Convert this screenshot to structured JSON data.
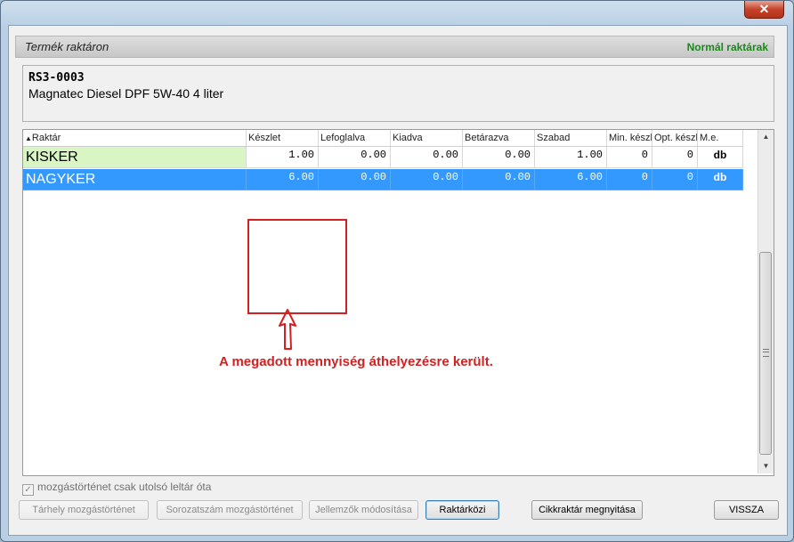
{
  "window": {
    "close_glyph": "✕"
  },
  "header": {
    "title": "Termék raktáron",
    "right_label": "Normál raktárak"
  },
  "product": {
    "code": "RS3-0003",
    "name": "Magnatec Diesel DPF 5W-40 4 liter"
  },
  "grid": {
    "sort_icon": "sort-ascending-icon",
    "columns": [
      "Raktár",
      "Készlet",
      "Lefoglalva",
      "Kiadva",
      "Betárazva",
      "Szabad",
      "Min. készl",
      "Opt. készl",
      "M.e."
    ],
    "rows": [
      {
        "raktar": "KISKER",
        "keszlet": "1.00",
        "lefoglalva": "0.00",
        "kiadva": "0.00",
        "betarazva": "0.00",
        "szabad": "1.00",
        "min": "0",
        "opt": "0",
        "me": "db"
      },
      {
        "raktar": "NAGYKER",
        "keszlet": "6.00",
        "lefoglalva": "0.00",
        "kiadva": "0.00",
        "betarazva": "0.00",
        "szabad": "6.00",
        "min": "0",
        "opt": "0",
        "me": "db"
      }
    ]
  },
  "annotation": {
    "text": "A megadott mennyiség áthelyezésre került."
  },
  "checkbox": {
    "label": "mozgástörténet csak utolsó leltár óta",
    "checked": true
  },
  "buttons": {
    "tarhely": "Tárhely mozgástörténet",
    "sorozatszam": "Sorozatszám mozgástörténet",
    "jellemzok": "Jellemzők módosítása",
    "raktarkozi": "Raktárközi",
    "cikkraktar": "Cikkraktár megnyitása",
    "vissza": "VISSZA"
  },
  "colors": {
    "accent_green": "#1a8a1a",
    "selection": "#3399ff",
    "kisker_bg": "#d9f5c4",
    "annotation_red": "#d42020"
  }
}
